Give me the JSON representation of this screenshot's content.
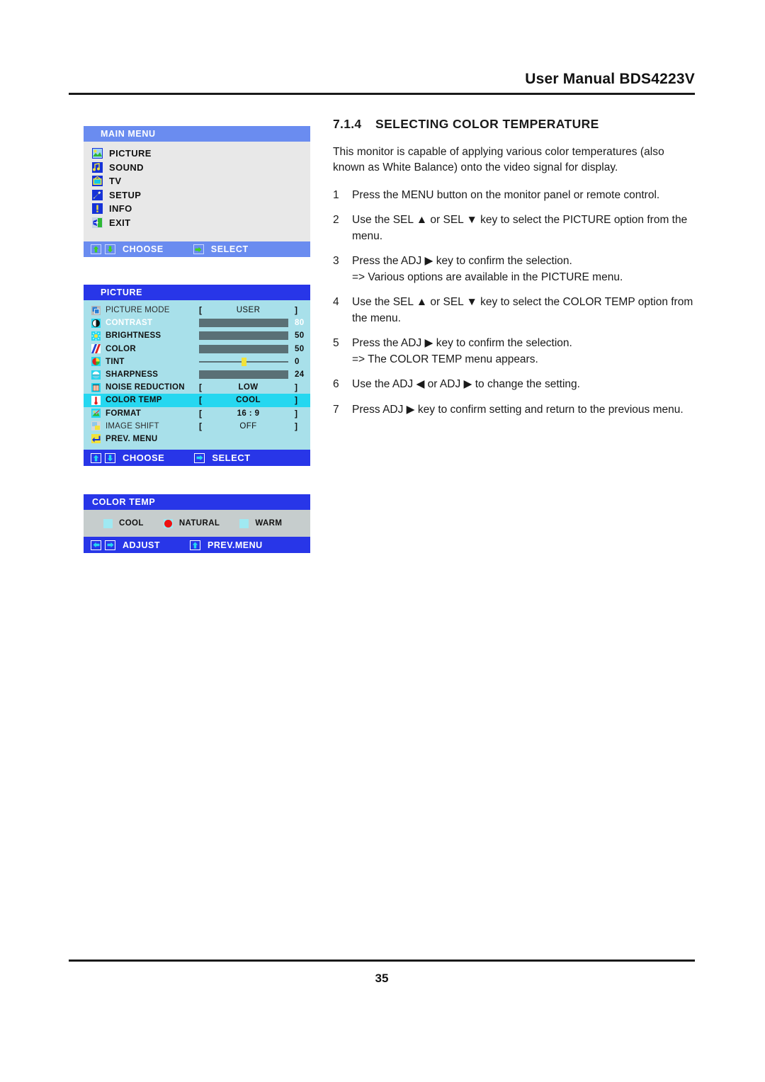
{
  "header": {
    "title": "User Manual BDS4223V"
  },
  "footer": {
    "page_number": "35"
  },
  "section": {
    "number": "7.1.4",
    "title": "SELECTING COLOR TEMPERATURE",
    "intro": "This monitor is capable of applying various color temperatures (also known as White Balance) onto the video signal for display.",
    "steps": [
      {
        "num": "1",
        "text": "Press the MENU button on the monitor panel or remote control.",
        "sub": ""
      },
      {
        "num": "2",
        "text": "Use the SEL ▲ or SEL ▼ key to select the PICTURE option from the menu.",
        "sub": ""
      },
      {
        "num": "3",
        "text": "Press the ADJ ▶ key to confirm the selection.",
        "sub": "=> Various options are available in the PICTURE menu."
      },
      {
        "num": "4",
        "text": "Use the SEL ▲ or SEL ▼ key to select the COLOR TEMP option from the menu.",
        "sub": ""
      },
      {
        "num": "5",
        "text": "Press the ADJ ▶ key to confirm the selection.",
        "sub": "=> The COLOR TEMP menu appears."
      },
      {
        "num": "6",
        "text": "Use the ADJ ◀ or ADJ ▶  to change the setting.",
        "sub": ""
      },
      {
        "num": "7",
        "text": "Press ADJ ▶ key to confirm setting and return to the previous menu.",
        "sub": ""
      }
    ]
  },
  "main_menu": {
    "title": "MAIN  MENU",
    "items": [
      {
        "label": "PICTURE",
        "icon": "picture-icon"
      },
      {
        "label": "SOUND",
        "icon": "sound-icon"
      },
      {
        "label": "TV",
        "icon": "tv-icon"
      },
      {
        "label": "SETUP",
        "icon": "wrench-icon"
      },
      {
        "label": "INFO",
        "icon": "info-icon"
      },
      {
        "label": "EXIT",
        "icon": "exit-icon"
      }
    ],
    "footer": {
      "choose": "CHOOSE",
      "select": "SELECT"
    },
    "colors": {
      "header": "#6a8cf0",
      "body": "#e8e8e8",
      "footer": "#6a8cf0",
      "arrow": "#3fd11f"
    }
  },
  "picture_menu": {
    "title": "PICTURE",
    "rows": [
      {
        "label": "PICTURE MODE",
        "icon": "picture-mode-icon",
        "type": "bracket",
        "value": "USER",
        "dim": true,
        "selected": false
      },
      {
        "label": "CONTRAST",
        "icon": "contrast-icon",
        "type": "bar",
        "value": "80",
        "fill": 68,
        "selected": false,
        "white": true
      },
      {
        "label": "BRIGHTNESS",
        "icon": "brightness-icon",
        "type": "bar",
        "value": "50",
        "fill": 50,
        "selected": false,
        "white": false
      },
      {
        "label": "COLOR",
        "icon": "color-icon",
        "type": "bar",
        "value": "50",
        "fill": 50,
        "selected": false,
        "white": false
      },
      {
        "label": "TINT",
        "icon": "tint-icon",
        "type": "line",
        "value": "0",
        "fill": 50,
        "selected": false,
        "white": false
      },
      {
        "label": "SHARPNESS",
        "icon": "sharpness-icon",
        "type": "bar",
        "value": "24",
        "fill": 24,
        "selected": false,
        "white": false
      },
      {
        "label": "NOISE  REDUCTION",
        "icon": "noise-reduction-icon",
        "type": "bracket",
        "value": "LOW",
        "dim": false,
        "selected": false
      },
      {
        "label": "COLOR  TEMP",
        "icon": "color-temp-icon",
        "type": "bracket",
        "value": "COOL",
        "dim": false,
        "selected": true
      },
      {
        "label": "FORMAT",
        "icon": "format-icon",
        "type": "bracket",
        "value": "16 : 9",
        "dim": false,
        "selected": false
      },
      {
        "label": "IMAGE SHIFT",
        "icon": "image-shift-icon",
        "type": "bracket",
        "value": "OFF",
        "dim": true,
        "selected": false
      },
      {
        "label": "PREV.  MENU",
        "icon": "prev-menu-icon",
        "type": "none",
        "value": "",
        "dim": false,
        "selected": false
      }
    ],
    "bracket_left": "[",
    "bracket_right": "]",
    "footer": {
      "choose": "CHOOSE",
      "select": "SELECT"
    },
    "colors": {
      "header": "#2836e8",
      "body": "#a8e0ea",
      "footer": "#2836e8",
      "highlight": "#25d7f0",
      "bar_fill": "#f7f0a3",
      "bar_track": "#5a7076"
    }
  },
  "colortemp_menu": {
    "title": "COLOR  TEMP",
    "options": [
      {
        "label": "COOL",
        "selected": false
      },
      {
        "label": "NATURAL",
        "selected": true
      },
      {
        "label": "WARM",
        "selected": false
      }
    ],
    "footer": {
      "adjust": "ADJUST",
      "prev": "PREV.MENU"
    },
    "colors": {
      "header": "#2836e8",
      "body": "#c6cdcd",
      "footer": "#2836e8",
      "radio": "#9fe9f2",
      "radio_on": "#ee1111"
    }
  }
}
